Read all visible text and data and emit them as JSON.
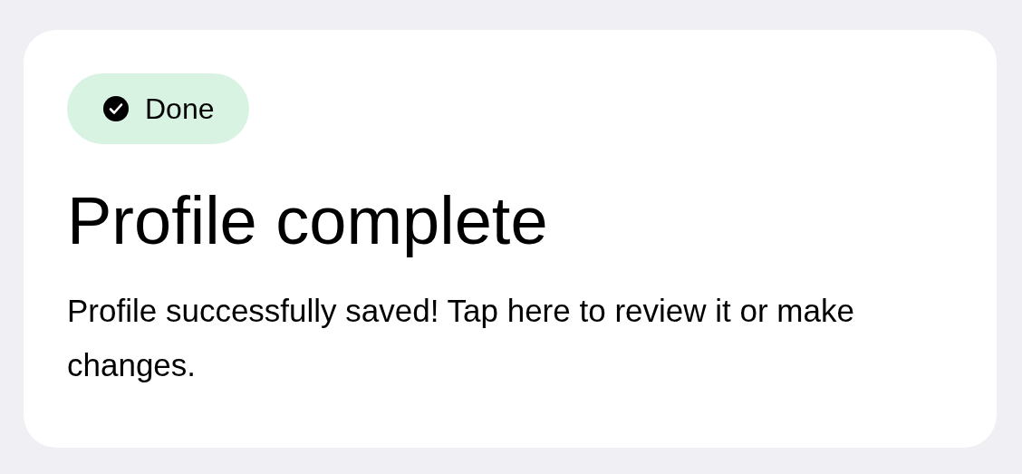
{
  "card": {
    "badge": {
      "label": "Done",
      "kind": "success"
    },
    "title": "Profile complete",
    "message": "Profile successfully saved! Tap here to review it or make changes."
  }
}
